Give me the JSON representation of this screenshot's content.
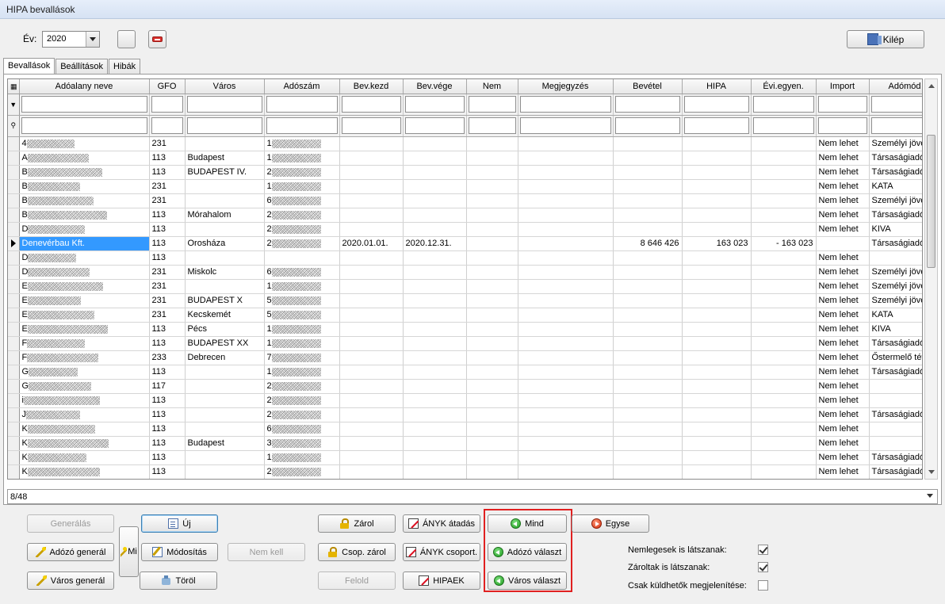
{
  "window": {
    "title": "HIPA bevallások"
  },
  "toolbar": {
    "year_label": "Év:",
    "year_value": "2020",
    "exit_label": "Kilép"
  },
  "tabs": [
    {
      "label": "Bevallások"
    },
    {
      "label": "Beállítások"
    },
    {
      "label": "Hibák"
    }
  ],
  "grid": {
    "columns": [
      "Adóalany neve",
      "GFO",
      "Város",
      "Adószám",
      "Bev.kezd",
      "Bev.vége",
      "Nem",
      "Megjegyzés",
      "Bevétel",
      "HIPA",
      "Évi.egyen.",
      "Import",
      "Adómód"
    ],
    "rows": [
      {
        "name": "4",
        "gfo": "231",
        "city": "",
        "tax": "1",
        "start": "",
        "end": "",
        "nem": "",
        "note": "",
        "rev": "",
        "hipa": "",
        "bal": "",
        "import": "Nem lehet",
        "mode": "Személyi jöve"
      },
      {
        "name": "A",
        "gfo": "113",
        "city": "Budapest",
        "tax": "1",
        "start": "",
        "end": "",
        "nem": "",
        "note": "",
        "rev": "",
        "hipa": "",
        "bal": "",
        "import": "Nem lehet",
        "mode": "Társaságiadó"
      },
      {
        "name": "B",
        "gfo": "113",
        "city": "BUDAPEST IV.",
        "tax": "2",
        "start": "",
        "end": "",
        "nem": "",
        "note": "",
        "rev": "",
        "hipa": "",
        "bal": "",
        "import": "Nem lehet",
        "mode": "Társaságiadó"
      },
      {
        "name": "B",
        "gfo": "231",
        "city": "",
        "tax": "1",
        "start": "",
        "end": "",
        "nem": "",
        "note": "",
        "rev": "",
        "hipa": "",
        "bal": "",
        "import": "Nem lehet",
        "mode": "KATA"
      },
      {
        "name": "B",
        "gfo": "231",
        "city": "",
        "tax": "6",
        "start": "",
        "end": "",
        "nem": "",
        "note": "",
        "rev": "",
        "hipa": "",
        "bal": "",
        "import": "Nem lehet",
        "mode": "Személyi jöve"
      },
      {
        "name": "B",
        "gfo": "113",
        "city": "Mórahalom",
        "tax": "2",
        "start": "",
        "end": "",
        "nem": "",
        "note": "",
        "rev": "",
        "hipa": "",
        "bal": "",
        "import": "Nem lehet",
        "mode": "Társaságiadó"
      },
      {
        "name": "D",
        "gfo": "113",
        "city": "",
        "tax": "2",
        "start": "",
        "end": "",
        "nem": "",
        "note": "",
        "rev": "",
        "hipa": "",
        "bal": "",
        "import": "Nem lehet",
        "mode": "KIVA"
      },
      {
        "name": "Denevérbau Kft.",
        "gfo": "113",
        "city": "Orosháza",
        "tax": "2",
        "start": "2020.01.01.",
        "end": "2020.12.31.",
        "nem": "",
        "note": "",
        "rev": "8 646 426",
        "hipa": "163 023",
        "bal": "- 163 023",
        "import": "",
        "mode": "Társaságiadó",
        "selected": true
      },
      {
        "name": "D",
        "gfo": "113",
        "city": "",
        "tax": "",
        "start": "",
        "end": "",
        "nem": "",
        "note": "",
        "rev": "",
        "hipa": "",
        "bal": "",
        "import": "Nem lehet",
        "mode": ""
      },
      {
        "name": "D",
        "gfo": "231",
        "city": "Miskolc",
        "tax": "6",
        "start": "",
        "end": "",
        "nem": "",
        "note": "",
        "rev": "",
        "hipa": "",
        "bal": "",
        "import": "Nem lehet",
        "mode": "Személyi jöve"
      },
      {
        "name": "E",
        "gfo": "231",
        "city": "",
        "tax": "1",
        "start": "",
        "end": "",
        "nem": "",
        "note": "",
        "rev": "",
        "hipa": "",
        "bal": "",
        "import": "Nem lehet",
        "mode": "Személyi jöve"
      },
      {
        "name": "E",
        "gfo": "231",
        "city": "BUDAPEST X",
        "tax": "5",
        "start": "",
        "end": "",
        "nem": "",
        "note": "",
        "rev": "",
        "hipa": "",
        "bal": "",
        "import": "Nem lehet",
        "mode": "Személyi jöve"
      },
      {
        "name": "E",
        "gfo": "231",
        "city": "Kecskemét",
        "tax": "5",
        "start": "",
        "end": "",
        "nem": "",
        "note": "",
        "rev": "",
        "hipa": "",
        "bal": "",
        "import": "Nem lehet",
        "mode": "KATA"
      },
      {
        "name": "E",
        "gfo": "113",
        "city": "Pécs",
        "tax": "1",
        "start": "",
        "end": "",
        "nem": "",
        "note": "",
        "rev": "",
        "hipa": "",
        "bal": "",
        "import": "Nem lehet",
        "mode": "KIVA"
      },
      {
        "name": "F",
        "gfo": "113",
        "city": "BUDAPEST XX",
        "tax": "1",
        "start": "",
        "end": "",
        "nem": "",
        "note": "",
        "rev": "",
        "hipa": "",
        "bal": "",
        "import": "Nem lehet",
        "mode": "Társaságiadó"
      },
      {
        "name": "F",
        "gfo": "233",
        "city": "Debrecen",
        "tax": "7",
        "start": "",
        "end": "",
        "nem": "",
        "note": "",
        "rev": "",
        "hipa": "",
        "bal": "",
        "import": "Nem lehet",
        "mode": "Őstermelő téte"
      },
      {
        "name": "G",
        "gfo": "113",
        "city": "",
        "tax": "1",
        "start": "",
        "end": "",
        "nem": "",
        "note": "",
        "rev": "",
        "hipa": "",
        "bal": "",
        "import": "Nem lehet",
        "mode": "Társaságiadó"
      },
      {
        "name": "G",
        "gfo": "117",
        "city": "",
        "tax": "2",
        "start": "",
        "end": "",
        "nem": "",
        "note": "",
        "rev": "",
        "hipa": "",
        "bal": "",
        "import": "Nem lehet",
        "mode": ""
      },
      {
        "name": "i",
        "gfo": "113",
        "city": "",
        "tax": "2",
        "start": "",
        "end": "",
        "nem": "",
        "note": "",
        "rev": "",
        "hipa": "",
        "bal": "",
        "import": "Nem lehet",
        "mode": ""
      },
      {
        "name": "J",
        "gfo": "113",
        "city": "",
        "tax": "2",
        "start": "",
        "end": "",
        "nem": "",
        "note": "",
        "rev": "",
        "hipa": "",
        "bal": "",
        "import": "Nem lehet",
        "mode": "Társaságiadó"
      },
      {
        "name": "K",
        "gfo": "113",
        "city": "",
        "tax": "6",
        "start": "",
        "end": "",
        "nem": "",
        "note": "",
        "rev": "",
        "hipa": "",
        "bal": "",
        "import": "Nem lehet",
        "mode": ""
      },
      {
        "name": "K",
        "gfo": "113",
        "city": "Budapest",
        "tax": "3",
        "start": "",
        "end": "",
        "nem": "",
        "note": "",
        "rev": "",
        "hipa": "",
        "bal": "",
        "import": "Nem lehet",
        "mode": ""
      },
      {
        "name": "K",
        "gfo": "113",
        "city": "",
        "tax": "1",
        "start": "",
        "end": "",
        "nem": "",
        "note": "",
        "rev": "",
        "hipa": "",
        "bal": "",
        "import": "Nem lehet",
        "mode": "Társaságiadó"
      },
      {
        "name": "K",
        "gfo": "113",
        "city": "",
        "tax": "2",
        "start": "",
        "end": "",
        "nem": "",
        "note": "",
        "rev": "",
        "hipa": "",
        "bal": "",
        "import": "Nem lehet",
        "mode": "Társaságiadó"
      }
    ]
  },
  "status": {
    "record_count": "8/48"
  },
  "buttons": {
    "generalas": "Generálás",
    "adozo_general": "Adózó generál",
    "varos_general": "Város generál",
    "mi": "Mi",
    "uj": "Új",
    "modositas": "Módosítás",
    "torol": "Töröl",
    "nem_kell": "Nem kell",
    "zarol": "Zárol",
    "csop_zarol": "Csop. zárol",
    "felold": "Felold",
    "anyk_atadas": "ÁNYK átadás",
    "anyk_csoport": "ÁNYK csoport.",
    "hipaek": "HIPAEK",
    "mind": "Mind",
    "adozo_valaszt": "Adózó választ",
    "varos_valaszt": "Város választ",
    "egyse": "Egyse"
  },
  "options": [
    {
      "label": "Nemlegesek is látszanak:",
      "checked": true
    },
    {
      "label": "Zároltak is látszanak:",
      "checked": true
    },
    {
      "label": "Csak küldhetők megjelenítése:",
      "checked": false
    }
  ]
}
